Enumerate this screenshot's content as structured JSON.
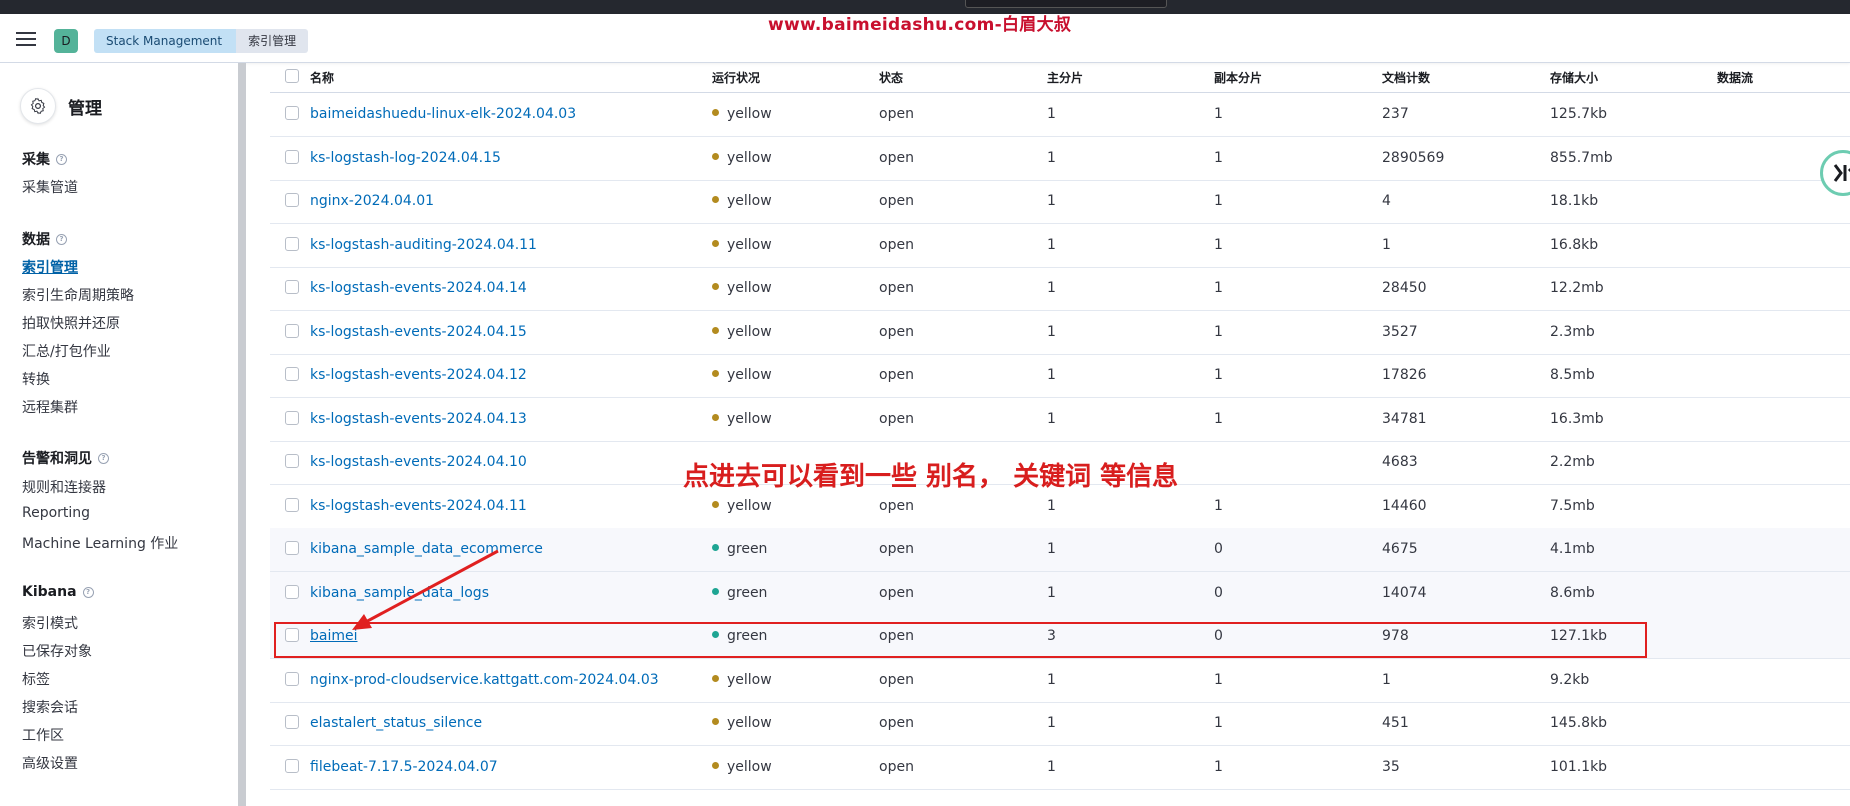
{
  "header": {
    "space_initial": "D",
    "breadcrumbs": [
      "Stack Management",
      "索引管理"
    ],
    "watermark": "www.baimeidashu.com-白眉大叔"
  },
  "sidebar": {
    "title": "管理",
    "groups": [
      {
        "label": "采集",
        "items": [
          "采集管道"
        ]
      },
      {
        "label": "数据",
        "items": [
          "索引管理",
          "索引生命周期策略",
          "拍取快照并还原",
          "汇总/打包作业",
          "转换",
          "远程集群"
        ]
      },
      {
        "label": "告警和洞见",
        "items": [
          "规则和连接器",
          "Reporting",
          "Machine Learning 作业"
        ]
      },
      {
        "label": "Kibana",
        "items": [
          "索引模式",
          "已保存对象",
          "标签",
          "搜索会话",
          "工作区",
          "高级设置"
        ]
      }
    ],
    "active_item": "索引管理"
  },
  "table": {
    "columns": [
      "名称",
      "运行状况",
      "状态",
      "主分片",
      "副本分片",
      "文档计数",
      "存储大小",
      "数据流"
    ],
    "rows": [
      {
        "name": "baimeidashuedu-linux-elk-2024.04.03",
        "health": "yellow",
        "status": "open",
        "primary": "1",
        "replica": "1",
        "docs": "237",
        "size": "125.7kb"
      },
      {
        "name": "ks-logstash-log-2024.04.15",
        "health": "yellow",
        "status": "open",
        "primary": "1",
        "replica": "1",
        "docs": "2890569",
        "size": "855.7mb"
      },
      {
        "name": "nginx-2024.04.01",
        "health": "yellow",
        "status": "open",
        "primary": "1",
        "replica": "1",
        "docs": "4",
        "size": "18.1kb"
      },
      {
        "name": "ks-logstash-auditing-2024.04.11",
        "health": "yellow",
        "status": "open",
        "primary": "1",
        "replica": "1",
        "docs": "1",
        "size": "16.8kb"
      },
      {
        "name": "ks-logstash-events-2024.04.14",
        "health": "yellow",
        "status": "open",
        "primary": "1",
        "replica": "1",
        "docs": "28450",
        "size": "12.2mb"
      },
      {
        "name": "ks-logstash-events-2024.04.15",
        "health": "yellow",
        "status": "open",
        "primary": "1",
        "replica": "1",
        "docs": "3527",
        "size": "2.3mb"
      },
      {
        "name": "ks-logstash-events-2024.04.12",
        "health": "yellow",
        "status": "open",
        "primary": "1",
        "replica": "1",
        "docs": "17826",
        "size": "8.5mb"
      },
      {
        "name": "ks-logstash-events-2024.04.13",
        "health": "yellow",
        "status": "open",
        "primary": "1",
        "replica": "1",
        "docs": "34781",
        "size": "16.3mb"
      },
      {
        "name": "ks-logstash-events-2024.04.10",
        "health": "",
        "status": "",
        "primary": "",
        "replica": "",
        "docs": "4683",
        "size": "2.2mb"
      },
      {
        "name": "ks-logstash-events-2024.04.11",
        "health": "yellow",
        "status": "open",
        "primary": "1",
        "replica": "1",
        "docs": "14460",
        "size": "7.5mb"
      },
      {
        "name": "kibana_sample_data_ecommerce",
        "health": "green",
        "status": "open",
        "primary": "1",
        "replica": "0",
        "docs": "4675",
        "size": "4.1mb"
      },
      {
        "name": "kibana_sample_data_logs",
        "health": "green",
        "status": "open",
        "primary": "1",
        "replica": "0",
        "docs": "14074",
        "size": "8.6mb"
      },
      {
        "name": "baimei",
        "health": "green",
        "status": "open",
        "primary": "3",
        "replica": "0",
        "docs": "978",
        "size": "127.1kb"
      },
      {
        "name": "nginx-prod-cloudservice.kattgatt.com-2024.04.03",
        "health": "yellow",
        "status": "open",
        "primary": "1",
        "replica": "1",
        "docs": "1",
        "size": "9.2kb"
      },
      {
        "name": "elastalert_status_silence",
        "health": "yellow",
        "status": "open",
        "primary": "1",
        "replica": "1",
        "docs": "451",
        "size": "145.8kb"
      },
      {
        "name": "filebeat-7.17.5-2024.04.07",
        "health": "yellow",
        "status": "open",
        "primary": "1",
        "replica": "1",
        "docs": "35",
        "size": "101.1kb"
      }
    ]
  },
  "annotation": {
    "callout": "点进去可以看到一些 别名， 关键词 等信息"
  },
  "colors": {
    "yellow": "#b38b1f",
    "green": "#1ea593",
    "link": "#006bb8",
    "annotation_red": "#d81e1e"
  }
}
